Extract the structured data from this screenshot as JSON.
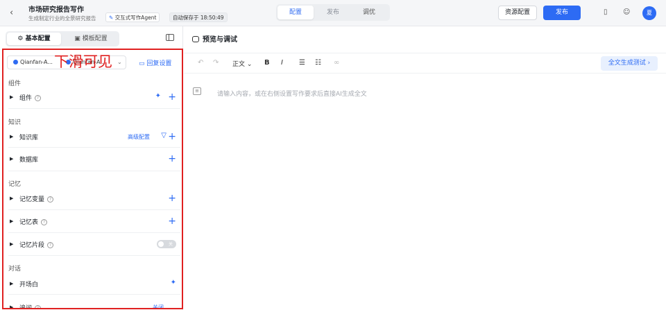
{
  "header": {
    "back_glyph": "‹",
    "title": "市场研究报告写作",
    "subtitle": "生成制定行业的全景研究报告",
    "agent_chip": "交互式写作Agent",
    "autosave": "自动保存于 18:50:49",
    "tabs": [
      "配置",
      "发布",
      "调优"
    ],
    "resources_button": "资源配置",
    "publish_button": "发布",
    "avatar": "夏",
    "colors": {
      "accent": "#2d6bf4",
      "annotation": "#e02020"
    }
  },
  "left": {
    "tabs": [
      "基本配置",
      "模板配置"
    ],
    "models": [
      "Qianfan-A...",
      "Qianfan-A..."
    ],
    "reply_settings": "回复设置",
    "annotation": "下滑可见",
    "sections": [
      {
        "title": "组件",
        "rows": [
          {
            "label": "组件",
            "help": true,
            "actions": [
              "sparkle-icon",
              "plus-icon"
            ]
          }
        ]
      },
      {
        "title": "知识",
        "rows": [
          {
            "label": "知识库",
            "link": "高级配置",
            "actions": [
              "filter-icon",
              "plus-icon"
            ]
          },
          {
            "label": "数据库",
            "actions": [
              "plus-icon"
            ]
          }
        ]
      },
      {
        "title": "记忆",
        "rows": [
          {
            "label": "记忆变量",
            "help": true,
            "actions": [
              "plus-icon"
            ]
          },
          {
            "label": "记忆表",
            "help": true,
            "actions": [
              "plus-icon"
            ]
          },
          {
            "label": "记忆片段",
            "help": true,
            "toggle": "关"
          }
        ]
      },
      {
        "title": "对话",
        "rows": [
          {
            "label": "开场白",
            "actions": [
              "sparkle-icon"
            ]
          },
          {
            "label": "追问",
            "help": true,
            "link": "关闭"
          }
        ]
      }
    ]
  },
  "right": {
    "title": "预览与调试",
    "style_select": "正文",
    "full_gen_button": "全文生成测试 ›",
    "placeholder": "请输入内容，或在右侧设置写作要求后直接AI生成全文"
  }
}
